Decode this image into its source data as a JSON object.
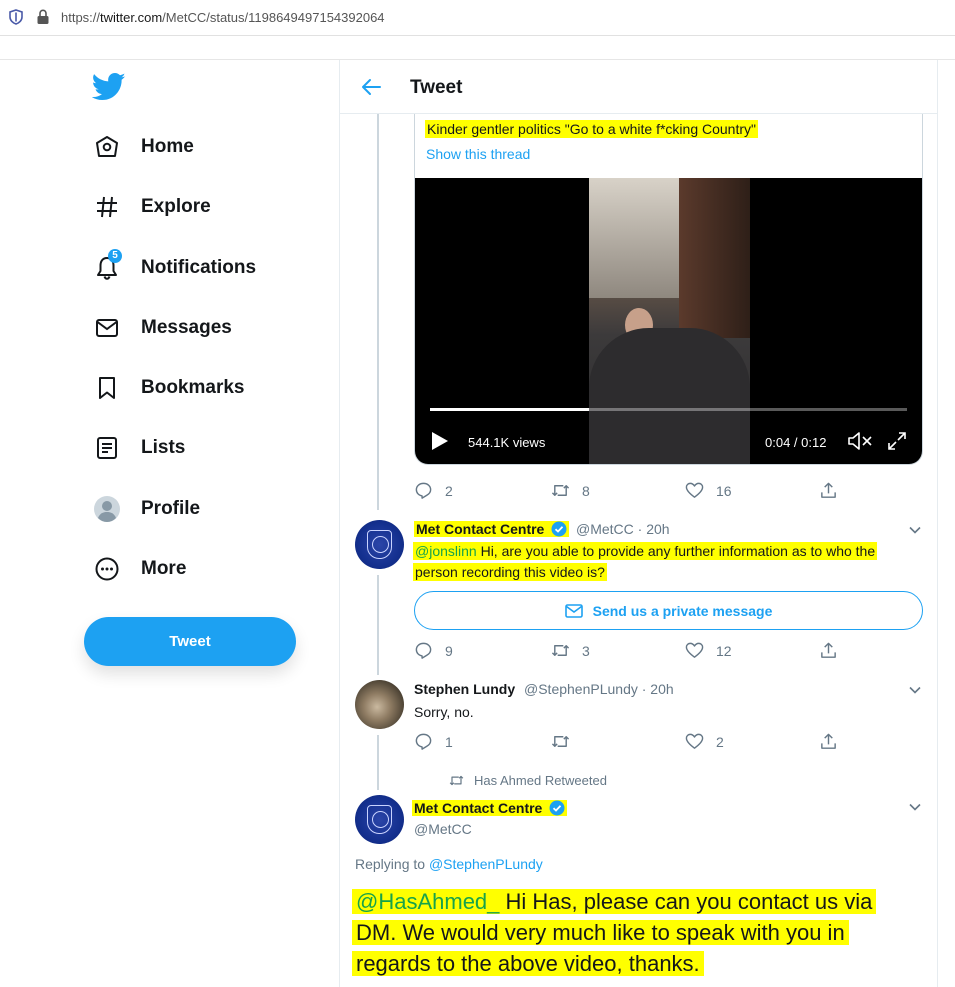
{
  "browser": {
    "url_prefix": "https://",
    "url_host": "twitter.com",
    "url_path": "/MetCC/status/1198649497154392064"
  },
  "sidebar": {
    "logo_icon": "twitter-bird-icon",
    "items": [
      {
        "label": "Home",
        "icon": "home-icon"
      },
      {
        "label": "Explore",
        "icon": "hashtag-icon"
      },
      {
        "label": "Notifications",
        "icon": "bell-icon",
        "badge": "5"
      },
      {
        "label": "Messages",
        "icon": "envelope-icon"
      },
      {
        "label": "Bookmarks",
        "icon": "bookmark-icon"
      },
      {
        "label": "Lists",
        "icon": "list-icon"
      },
      {
        "label": "Profile",
        "icon": "profile-icon"
      },
      {
        "label": "More",
        "icon": "more-icon"
      }
    ],
    "tweet_button": "Tweet"
  },
  "header": {
    "title": "Tweet"
  },
  "quoted": {
    "text": "Kinder gentler politics \"Go to a white f*cking Country\"",
    "show_thread": "Show this thread",
    "video": {
      "views": "544.1K views",
      "time": "0:04 / 0:12",
      "progress": 0.333
    },
    "actions": {
      "replies": "2",
      "retweets": "8",
      "likes": "16"
    }
  },
  "tweet1": {
    "name": "Met Contact Centre",
    "handle": "@MetCC",
    "time": "· 20h",
    "mention": "@jonslinn",
    "text_line1": " Hi, are you able to provide any further information as to who the",
    "text_line2": "person recording this video is?",
    "dm_button": "Send us a private message",
    "actions": {
      "replies": "9",
      "retweets": "3",
      "likes": "12"
    }
  },
  "tweet2": {
    "name": "Stephen Lundy",
    "handle": "@StephenPLundy",
    "time": "· 20h",
    "text": "Sorry, no.",
    "actions": {
      "replies": "1",
      "retweets": "",
      "likes": "2"
    }
  },
  "retweeted_by": "Has Ahmed Retweeted",
  "main_tweet": {
    "name": "Met Contact Centre",
    "handle": "@MetCC",
    "replying_label": "Replying to ",
    "replying_to": "@StephenPLundy",
    "mention": "@HasAhmed_",
    "line1": " Hi Has, please can you contact us via",
    "line2": "DM. We would very much like to speak with you in",
    "line3": "regards to the above video, thanks."
  },
  "colors": {
    "twitter_blue": "#1da1f2",
    "highlight": "#ffff00",
    "text_secondary": "#657786"
  }
}
